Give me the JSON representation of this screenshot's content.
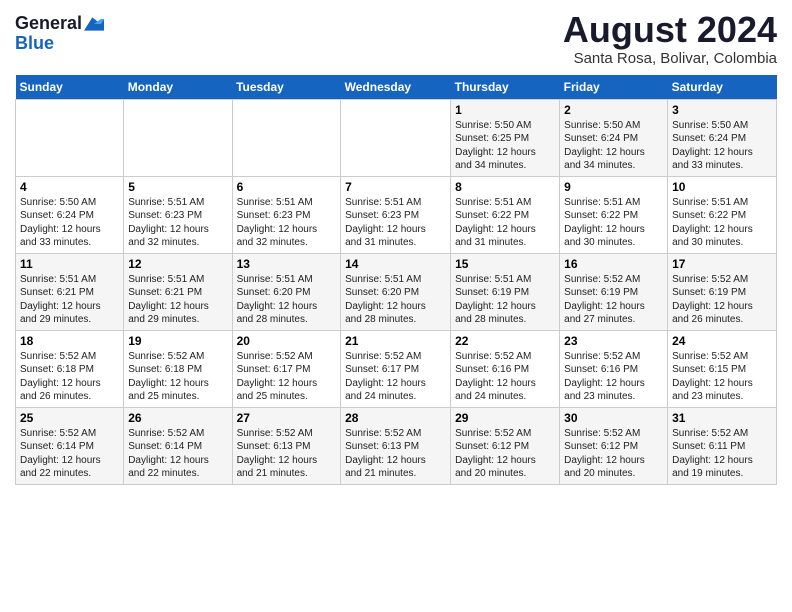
{
  "header": {
    "logo_line1": "General",
    "logo_line2": "Blue",
    "main_title": "August 2024",
    "subtitle": "Santa Rosa, Bolivar, Colombia"
  },
  "calendar": {
    "days_of_week": [
      "Sunday",
      "Monday",
      "Tuesday",
      "Wednesday",
      "Thursday",
      "Friday",
      "Saturday"
    ],
    "weeks": [
      [
        {
          "day": "",
          "info": ""
        },
        {
          "day": "",
          "info": ""
        },
        {
          "day": "",
          "info": ""
        },
        {
          "day": "",
          "info": ""
        },
        {
          "day": "1",
          "info": "Sunrise: 5:50 AM\nSunset: 6:25 PM\nDaylight: 12 hours\nand 34 minutes."
        },
        {
          "day": "2",
          "info": "Sunrise: 5:50 AM\nSunset: 6:24 PM\nDaylight: 12 hours\nand 34 minutes."
        },
        {
          "day": "3",
          "info": "Sunrise: 5:50 AM\nSunset: 6:24 PM\nDaylight: 12 hours\nand 33 minutes."
        }
      ],
      [
        {
          "day": "4",
          "info": "Sunrise: 5:50 AM\nSunset: 6:24 PM\nDaylight: 12 hours\nand 33 minutes."
        },
        {
          "day": "5",
          "info": "Sunrise: 5:51 AM\nSunset: 6:23 PM\nDaylight: 12 hours\nand 32 minutes."
        },
        {
          "day": "6",
          "info": "Sunrise: 5:51 AM\nSunset: 6:23 PM\nDaylight: 12 hours\nand 32 minutes."
        },
        {
          "day": "7",
          "info": "Sunrise: 5:51 AM\nSunset: 6:23 PM\nDaylight: 12 hours\nand 31 minutes."
        },
        {
          "day": "8",
          "info": "Sunrise: 5:51 AM\nSunset: 6:22 PM\nDaylight: 12 hours\nand 31 minutes."
        },
        {
          "day": "9",
          "info": "Sunrise: 5:51 AM\nSunset: 6:22 PM\nDaylight: 12 hours\nand 30 minutes."
        },
        {
          "day": "10",
          "info": "Sunrise: 5:51 AM\nSunset: 6:22 PM\nDaylight: 12 hours\nand 30 minutes."
        }
      ],
      [
        {
          "day": "11",
          "info": "Sunrise: 5:51 AM\nSunset: 6:21 PM\nDaylight: 12 hours\nand 29 minutes."
        },
        {
          "day": "12",
          "info": "Sunrise: 5:51 AM\nSunset: 6:21 PM\nDaylight: 12 hours\nand 29 minutes."
        },
        {
          "day": "13",
          "info": "Sunrise: 5:51 AM\nSunset: 6:20 PM\nDaylight: 12 hours\nand 28 minutes."
        },
        {
          "day": "14",
          "info": "Sunrise: 5:51 AM\nSunset: 6:20 PM\nDaylight: 12 hours\nand 28 minutes."
        },
        {
          "day": "15",
          "info": "Sunrise: 5:51 AM\nSunset: 6:19 PM\nDaylight: 12 hours\nand 28 minutes."
        },
        {
          "day": "16",
          "info": "Sunrise: 5:52 AM\nSunset: 6:19 PM\nDaylight: 12 hours\nand 27 minutes."
        },
        {
          "day": "17",
          "info": "Sunrise: 5:52 AM\nSunset: 6:19 PM\nDaylight: 12 hours\nand 26 minutes."
        }
      ],
      [
        {
          "day": "18",
          "info": "Sunrise: 5:52 AM\nSunset: 6:18 PM\nDaylight: 12 hours\nand 26 minutes."
        },
        {
          "day": "19",
          "info": "Sunrise: 5:52 AM\nSunset: 6:18 PM\nDaylight: 12 hours\nand 25 minutes."
        },
        {
          "day": "20",
          "info": "Sunrise: 5:52 AM\nSunset: 6:17 PM\nDaylight: 12 hours\nand 25 minutes."
        },
        {
          "day": "21",
          "info": "Sunrise: 5:52 AM\nSunset: 6:17 PM\nDaylight: 12 hours\nand 24 minutes."
        },
        {
          "day": "22",
          "info": "Sunrise: 5:52 AM\nSunset: 6:16 PM\nDaylight: 12 hours\nand 24 minutes."
        },
        {
          "day": "23",
          "info": "Sunrise: 5:52 AM\nSunset: 6:16 PM\nDaylight: 12 hours\nand 23 minutes."
        },
        {
          "day": "24",
          "info": "Sunrise: 5:52 AM\nSunset: 6:15 PM\nDaylight: 12 hours\nand 23 minutes."
        }
      ],
      [
        {
          "day": "25",
          "info": "Sunrise: 5:52 AM\nSunset: 6:14 PM\nDaylight: 12 hours\nand 22 minutes."
        },
        {
          "day": "26",
          "info": "Sunrise: 5:52 AM\nSunset: 6:14 PM\nDaylight: 12 hours\nand 22 minutes."
        },
        {
          "day": "27",
          "info": "Sunrise: 5:52 AM\nSunset: 6:13 PM\nDaylight: 12 hours\nand 21 minutes."
        },
        {
          "day": "28",
          "info": "Sunrise: 5:52 AM\nSunset: 6:13 PM\nDaylight: 12 hours\nand 21 minutes."
        },
        {
          "day": "29",
          "info": "Sunrise: 5:52 AM\nSunset: 6:12 PM\nDaylight: 12 hours\nand 20 minutes."
        },
        {
          "day": "30",
          "info": "Sunrise: 5:52 AM\nSunset: 6:12 PM\nDaylight: 12 hours\nand 20 minutes."
        },
        {
          "day": "31",
          "info": "Sunrise: 5:52 AM\nSunset: 6:11 PM\nDaylight: 12 hours\nand 19 minutes."
        }
      ]
    ]
  }
}
